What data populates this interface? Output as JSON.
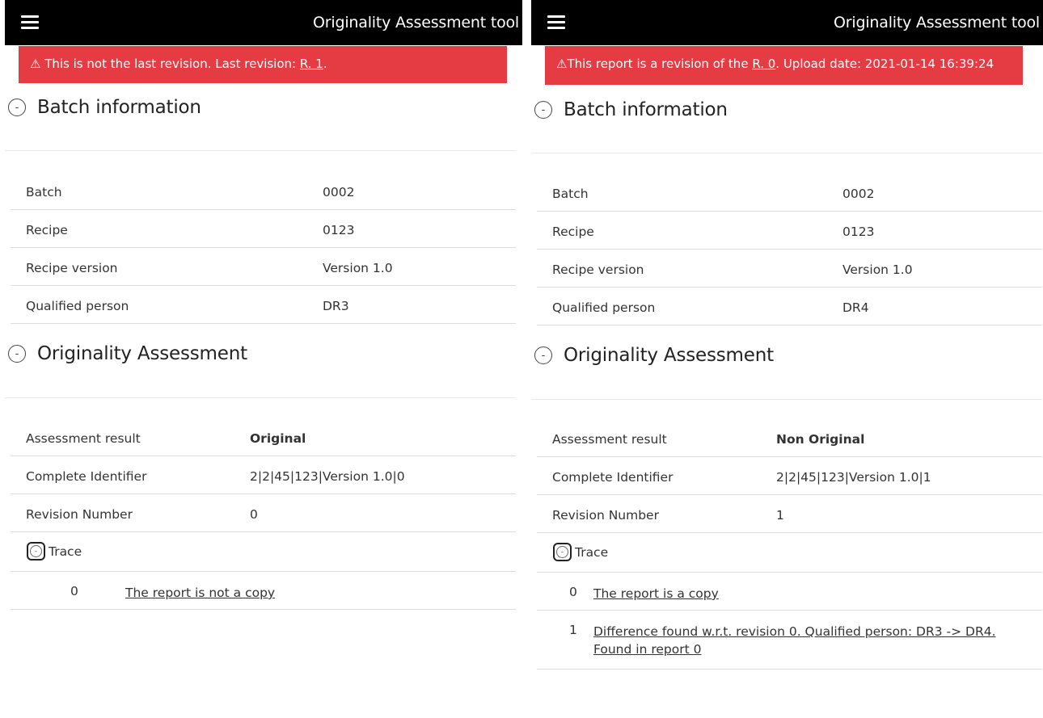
{
  "app_title": "Originality Assessment tool",
  "colors": {
    "banner": "#e53c43",
    "original": "#4e8a2d",
    "non_original": "#d9333a"
  },
  "left": {
    "banner": {
      "icon": "warning-icon",
      "prefix": "⚠ This is not the last revision. Last revision: ",
      "link": "R. 1",
      "suffix": "."
    },
    "batch_section_title": "Batch information",
    "batch": [
      {
        "label": "Batch",
        "value": "0002"
      },
      {
        "label": "Recipe",
        "value": "0123"
      },
      {
        "label": "Recipe version",
        "value": "Version 1.0"
      },
      {
        "label": "Qualified person",
        "value": "DR3"
      }
    ],
    "assessment_section_title": "Originality Assessment",
    "assessment": [
      {
        "label": "Assessment result",
        "value": "Original"
      },
      {
        "label": "Complete Identifier",
        "value": "2|2|45|123|Version 1.0|0"
      },
      {
        "label": "Revision Number",
        "value": "0"
      }
    ],
    "trace_label": "Trace",
    "trace_items": [
      {
        "num": "0",
        "text": "The report is not a copy"
      }
    ]
  },
  "right": {
    "banner": {
      "icon": "warning-icon",
      "prefix": "⚠This report is a revision of the ",
      "link": "R. 0",
      "suffix": ". Upload date: 2021-01-14 16:39:24"
    },
    "batch_section_title": "Batch information",
    "batch": [
      {
        "label": "Batch",
        "value": "0002"
      },
      {
        "label": "Recipe",
        "value": "0123"
      },
      {
        "label": "Recipe version",
        "value": "Version 1.0"
      },
      {
        "label": "Qualified person",
        "value": "DR4"
      }
    ],
    "assessment_section_title": "Originality Assessment",
    "assessment": [
      {
        "label": "Assessment result",
        "value": "Non Original"
      },
      {
        "label": "Complete Identifier",
        "value": "2|2|45|123|Version 1.0|1"
      },
      {
        "label": "Revision Number",
        "value": "1"
      }
    ],
    "trace_label": "Trace",
    "trace_items": [
      {
        "num": "0",
        "text": "The report is a copy"
      },
      {
        "num": "1",
        "text": "Difference found w.r.t. revision 0. Qualified person: DR3 -> DR4.",
        "text2": "Found in report 0"
      }
    ]
  }
}
